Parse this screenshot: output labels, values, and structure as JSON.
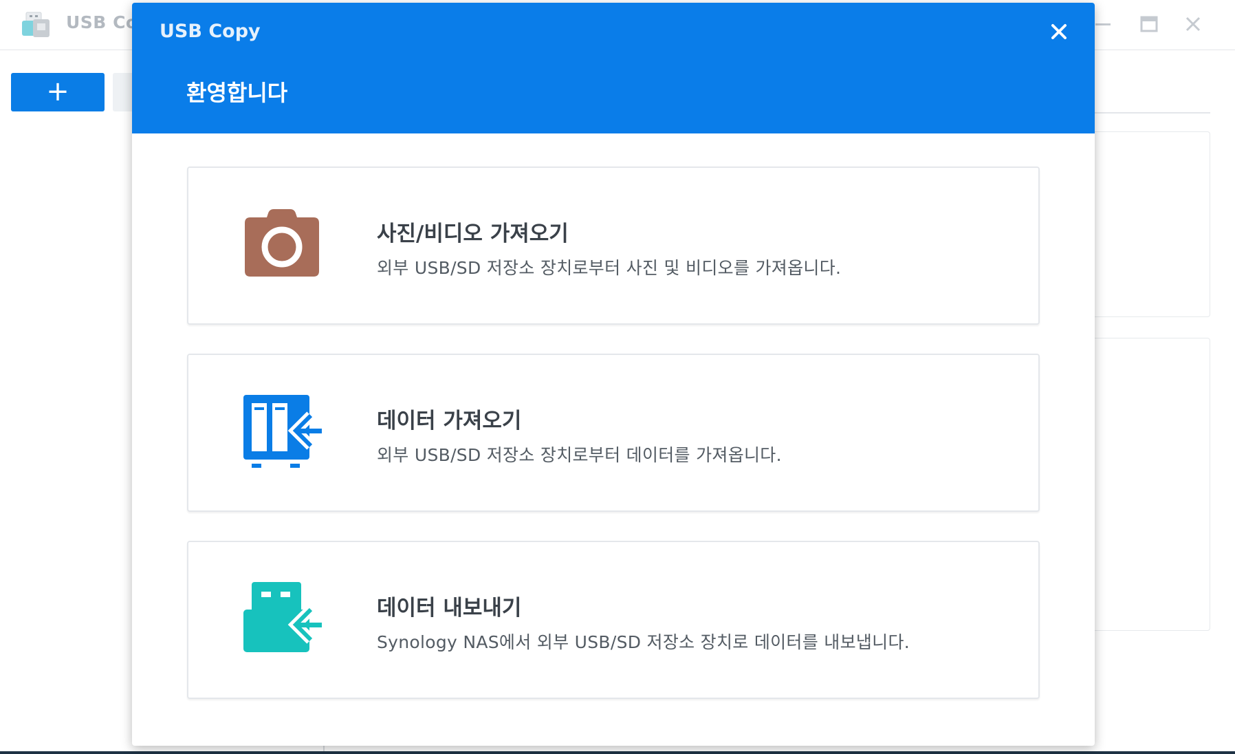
{
  "app": {
    "title": "USB Co",
    "add_button_label": "+"
  },
  "dialog": {
    "title": "USB Copy",
    "welcome": "환영합니다",
    "options": [
      {
        "title": "사진/비디오 가져오기",
        "description": "외부 USB/SD 저장소 장치로부터 사진 및 비디오를 가져옵니다.",
        "icon": "camera-icon"
      },
      {
        "title": "데이터 가져오기",
        "description": "외부 USB/SD 저장소 장치로부터 데이터를 가져옵니다.",
        "icon": "nas-import-icon"
      },
      {
        "title": "데이터 내보내기",
        "description": "Synology NAS에서 외부 USB/SD 저장소 장치로 데이터를 내보냅니다.",
        "icon": "usb-export-icon"
      }
    ]
  },
  "colors": {
    "header_blue": "#0a7de9",
    "camera": "#a86d59",
    "nas_blue": "#0a7de6",
    "usb_teal": "#17c2bd"
  }
}
